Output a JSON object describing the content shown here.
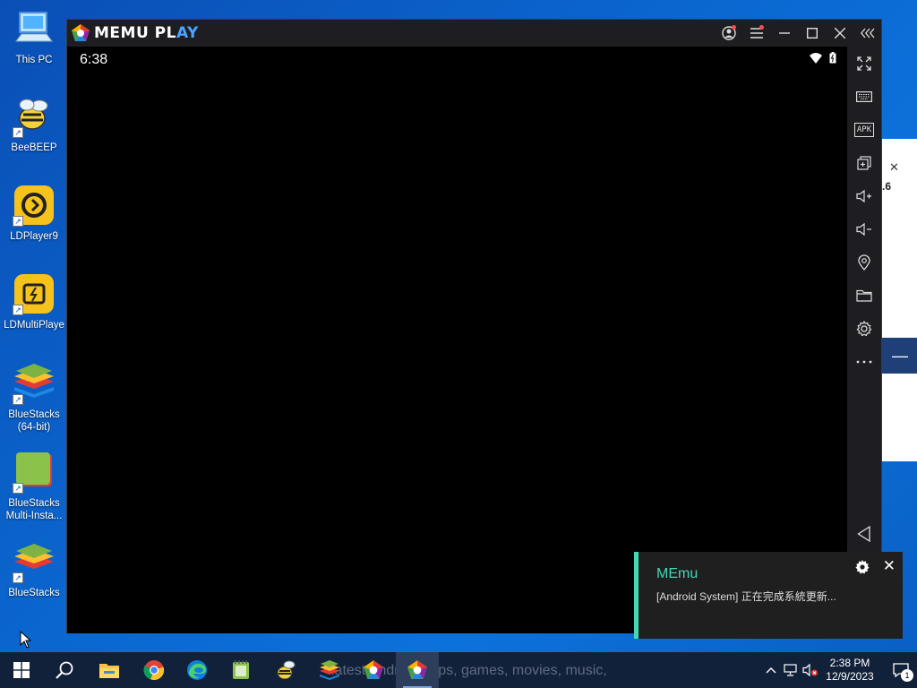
{
  "desktop": {
    "icons": [
      {
        "label": "This PC",
        "icon": "this-pc-icon"
      },
      {
        "label": "BeeBEEP",
        "icon": "beebeep-icon"
      },
      {
        "label": "LDPlayer9",
        "icon": "ldplayer-icon"
      },
      {
        "label": "LDMultiPlaye",
        "icon": "ldmultiplayer-icon"
      },
      {
        "label": "BlueStacks\n(64-bit)",
        "icon": "bluestacks-icon"
      },
      {
        "label": "BlueStacks\nMulti-Insta...",
        "icon": "bluestacks-multi-icon"
      },
      {
        "label": "BlueStacks",
        "icon": "bluestacks-icon"
      }
    ]
  },
  "memu": {
    "logo_text_a": "MEMU PL",
    "logo_text_b": "AY",
    "status_time": "6:38",
    "sidebar_tools": [
      "fullscreen-icon",
      "keyboard-icon",
      "apk-icon",
      "multi-window-icon",
      "volume-up-icon",
      "volume-down-icon",
      "location-icon",
      "folder-icon",
      "settings-icon",
      "more-icon",
      "back-icon"
    ],
    "apk_label": "APK"
  },
  "background_window": {
    "version_fragment": ".6"
  },
  "toast": {
    "app": "MEmu",
    "message": "[Android System] 正在完成系統更新..."
  },
  "taskbar": {
    "ghost_text": "latest Android apps, games, movies, music,",
    "apps": [
      "file-explorer-icon",
      "chrome-icon",
      "edge-icon",
      "notepad-icon",
      "beebeep-icon",
      "bluestacks-icon",
      "memu-icon",
      "memu-play-icon"
    ],
    "clock_time": "2:38 PM",
    "clock_date": "12/9/2023",
    "notification_count": "1"
  },
  "colors": {
    "desktop_blue": "#0b67d0",
    "memu_chrome": "#1e1e22",
    "toast_accent": "#44d7b6",
    "taskbar": "#12213a"
  }
}
